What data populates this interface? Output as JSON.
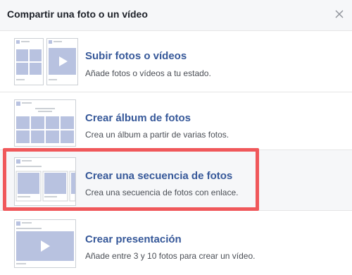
{
  "dialog": {
    "title": "Compartir una foto o un vídeo",
    "close_icon": "close-icon"
  },
  "options": [
    {
      "title": "Subir fotos o vídeos",
      "description": "Añade fotos o vídeos a tu estado.",
      "icon": "upload-photos-thumbnail"
    },
    {
      "title": "Crear álbum de fotos",
      "description": "Crea un álbum a partir de varias fotos.",
      "icon": "album-thumbnail"
    },
    {
      "title": "Crear una secuencia de fotos",
      "description": "Crea una secuencia de fotos con enlace.",
      "icon": "carousel-thumbnail",
      "highlighted": true
    },
    {
      "title": "Crear presentación",
      "description": "Añade entre 3 y 10 fotos para crear un vídeo.",
      "icon": "slideshow-thumbnail"
    }
  ],
  "colors": {
    "link": "#365899",
    "highlight": "#f0585b",
    "placeholder": "#b8c2e0"
  }
}
